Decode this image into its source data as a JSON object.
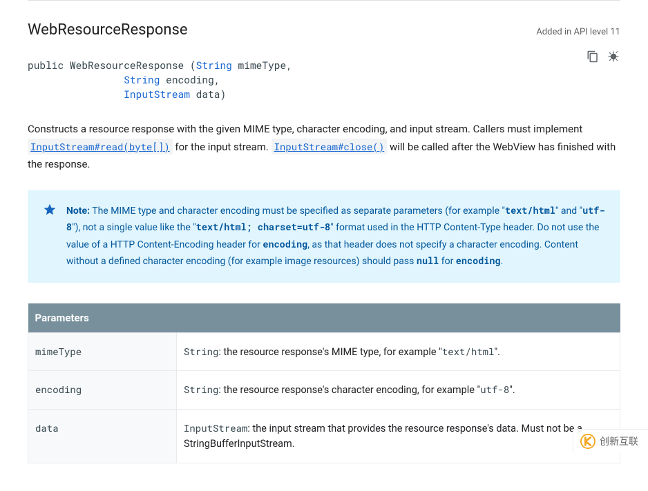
{
  "header": {
    "title": "WebResourceResponse",
    "added_in": "Added in API level 11"
  },
  "signature": {
    "prefix": "public WebResourceResponse (",
    "type_string1": "String",
    "param1": " mimeType,",
    "indent": "                ",
    "type_string2": "String",
    "param2": " encoding,",
    "type_inputstream": "InputStream",
    "param3": " data)"
  },
  "description": {
    "part1": "Constructs a resource response with the given MIME type, character encoding, and input stream. Callers must implement ",
    "link1": "InputStream#read(byte[])",
    "part2": " for the input stream. ",
    "link2": "InputStream#close()",
    "part3": " will be called after the WebView has finished with the response."
  },
  "note": {
    "label": "Note:",
    "p1": " The MIME type and character encoding must be specified as separate parameters (for example \"",
    "c1": "text/html",
    "p2": "\" and \"",
    "c2": "utf-8",
    "p3": "\"), not a single value like the \"",
    "c3": "text/html; charset=utf-8",
    "p4": "\" format used in the HTTP Content-Type header. Do not use the value of a HTTP Content-Encoding header for ",
    "c4": "encoding",
    "p5": ", as that header does not specify a character encoding. Content without a defined character encoding (for example image resources) should pass ",
    "c5": "null",
    "p6": " for ",
    "c6": "encoding",
    "p7": "."
  },
  "params_table": {
    "header": "Parameters",
    "rows": [
      {
        "name": "mimeType",
        "type": "String",
        "desc_pre": ": the resource response's MIME type, for example \"",
        "code": "text/html",
        "desc_post": "\"."
      },
      {
        "name": "encoding",
        "type": "String",
        "desc_pre": ": the resource response's character encoding, for example \"",
        "code": "utf-8",
        "desc_post": "\"."
      },
      {
        "name": "data",
        "type": "InputStream",
        "desc_pre": ": the input stream that provides the resource response's data. Must not be a StringBufferInputStream.",
        "code": "",
        "desc_post": ""
      }
    ]
  },
  "watermark": {
    "text": "创新互联"
  }
}
